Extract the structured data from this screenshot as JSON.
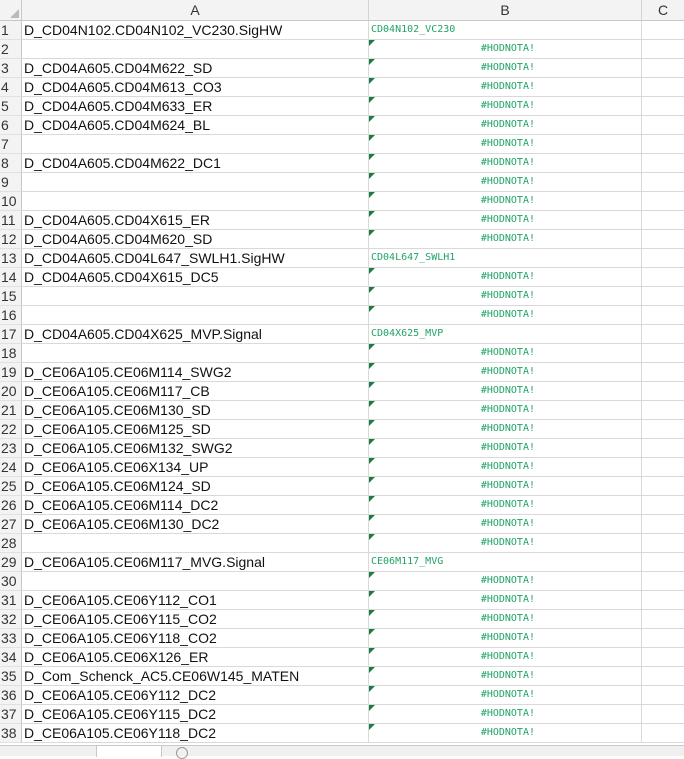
{
  "columns": [
    "A",
    "B",
    "C"
  ],
  "rows": [
    {
      "n": "1",
      "a": "D_CD04N102.CD04N102_VC230.SigHW",
      "b": "CD04N102_VC230",
      "err": false,
      "tri": false
    },
    {
      "n": "2",
      "a": "",
      "b": "#HODNOTA!",
      "err": true,
      "tri": true
    },
    {
      "n": "3",
      "a": "D_CD04A605.CD04M622_SD",
      "b": "#HODNOTA!",
      "err": true,
      "tri": true
    },
    {
      "n": "4",
      "a": "D_CD04A605.CD04M613_CO3",
      "b": "#HODNOTA!",
      "err": true,
      "tri": true
    },
    {
      "n": "5",
      "a": "D_CD04A605.CD04M633_ER",
      "b": "#HODNOTA!",
      "err": true,
      "tri": true
    },
    {
      "n": "6",
      "a": "D_CD04A605.CD04M624_BL",
      "b": "#HODNOTA!",
      "err": true,
      "tri": true
    },
    {
      "n": "7",
      "a": "",
      "b": "#HODNOTA!",
      "err": true,
      "tri": true
    },
    {
      "n": "8",
      "a": "D_CD04A605.CD04M622_DC1",
      "b": "#HODNOTA!",
      "err": true,
      "tri": true
    },
    {
      "n": "9",
      "a": "",
      "b": "#HODNOTA!",
      "err": true,
      "tri": true
    },
    {
      "n": "10",
      "a": "",
      "b": "#HODNOTA!",
      "err": true,
      "tri": true
    },
    {
      "n": "11",
      "a": "D_CD04A605.CD04X615_ER",
      "b": "#HODNOTA!",
      "err": true,
      "tri": true
    },
    {
      "n": "12",
      "a": "D_CD04A605.CD04M620_SD",
      "b": "#HODNOTA!",
      "err": true,
      "tri": true
    },
    {
      "n": "13",
      "a": "D_CD04A605.CD04L647_SWLH1.SigHW",
      "b": "CD04L647_SWLH1",
      "err": false,
      "tri": false
    },
    {
      "n": "14",
      "a": "D_CD04A605.CD04X615_DC5",
      "b": "#HODNOTA!",
      "err": true,
      "tri": true
    },
    {
      "n": "15",
      "a": "",
      "b": "#HODNOTA!",
      "err": true,
      "tri": true
    },
    {
      "n": "16",
      "a": "",
      "b": "#HODNOTA!",
      "err": true,
      "tri": true
    },
    {
      "n": "17",
      "a": "D_CD04A605.CD04X625_MVP.Signal",
      "b": "CD04X625_MVP",
      "err": false,
      "tri": false
    },
    {
      "n": "18",
      "a": "",
      "b": "#HODNOTA!",
      "err": true,
      "tri": true
    },
    {
      "n": "19",
      "a": "D_CE06A105.CE06M114_SWG2",
      "b": "#HODNOTA!",
      "err": true,
      "tri": true
    },
    {
      "n": "20",
      "a": "D_CE06A105.CE06M117_CB",
      "b": "#HODNOTA!",
      "err": true,
      "tri": true
    },
    {
      "n": "21",
      "a": "D_CE06A105.CE06M130_SD",
      "b": "#HODNOTA!",
      "err": true,
      "tri": true
    },
    {
      "n": "22",
      "a": "D_CE06A105.CE06M125_SD",
      "b": "#HODNOTA!",
      "err": true,
      "tri": true
    },
    {
      "n": "23",
      "a": "D_CE06A105.CE06M132_SWG2",
      "b": "#HODNOTA!",
      "err": true,
      "tri": true
    },
    {
      "n": "24",
      "a": "D_CE06A105.CE06X134_UP",
      "b": "#HODNOTA!",
      "err": true,
      "tri": true
    },
    {
      "n": "25",
      "a": "D_CE06A105.CE06M124_SD",
      "b": "#HODNOTA!",
      "err": true,
      "tri": true
    },
    {
      "n": "26",
      "a": "D_CE06A105.CE06M114_DC2",
      "b": "#HODNOTA!",
      "err": true,
      "tri": true
    },
    {
      "n": "27",
      "a": "D_CE06A105.CE06M130_DC2",
      "b": "#HODNOTA!",
      "err": true,
      "tri": true
    },
    {
      "n": "28",
      "a": "",
      "b": "#HODNOTA!",
      "err": true,
      "tri": true
    },
    {
      "n": "29",
      "a": "D_CE06A105.CE06M117_MVG.Signal",
      "b": "CE06M117_MVG",
      "err": false,
      "tri": false
    },
    {
      "n": "30",
      "a": "",
      "b": "#HODNOTA!",
      "err": true,
      "tri": true
    },
    {
      "n": "31",
      "a": "D_CE06A105.CE06Y112_CO1",
      "b": "#HODNOTA!",
      "err": true,
      "tri": true
    },
    {
      "n": "32",
      "a": "D_CE06A105.CE06Y115_CO2",
      "b": "#HODNOTA!",
      "err": true,
      "tri": true
    },
    {
      "n": "33",
      "a": "D_CE06A105.CE06Y118_CO2",
      "b": "#HODNOTA!",
      "err": true,
      "tri": true
    },
    {
      "n": "34",
      "a": "D_CE06A105.CE06X126_ER",
      "b": "#HODNOTA!",
      "err": true,
      "tri": true
    },
    {
      "n": "35",
      "a": "D_Com_Schenck_AC5.CE06W145_MATEN",
      "b": "#HODNOTA!",
      "err": true,
      "tri": true
    },
    {
      "n": "36",
      "a": "D_CE06A105.CE06Y112_DC2",
      "b": "#HODNOTA!",
      "err": true,
      "tri": true
    },
    {
      "n": "37",
      "a": "D_CE06A105.CE06Y115_DC2",
      "b": "#HODNOTA!",
      "err": true,
      "tri": true
    },
    {
      "n": "38",
      "a": "D_CE06A105.CE06Y118_DC2",
      "b": "#HODNOTA!",
      "err": true,
      "tri": true
    }
  ],
  "colors": {
    "value_text": "#21a366",
    "error_marker": "#1e7b45"
  }
}
